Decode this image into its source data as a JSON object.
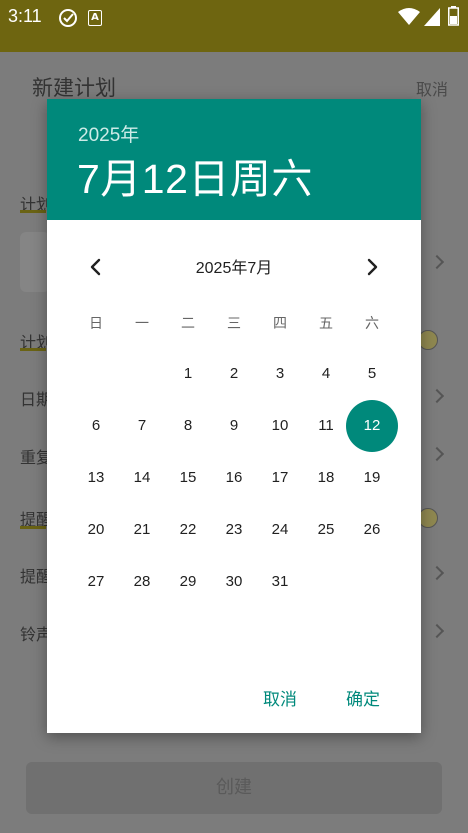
{
  "status_bar": {
    "time": "3:11",
    "icons": [
      "check-circle-icon",
      "a-badge-icon",
      "wifi-icon",
      "signal-icon",
      "battery-icon"
    ]
  },
  "background_page": {
    "title": "新建计划",
    "cancel_label": "取消",
    "row_labels": [
      "计划",
      "计划",
      "日期",
      "重复",
      "提醒",
      "提醒",
      "铃声"
    ],
    "create_label": "创建"
  },
  "dialog": {
    "header_year": "2025年",
    "header_date": "7月12日周六",
    "month_label": "2025年7月",
    "weekdays": [
      "日",
      "一",
      "二",
      "三",
      "四",
      "五",
      "六"
    ],
    "days": [
      "1",
      "2",
      "3",
      "4",
      "5",
      "6",
      "7",
      "8",
      "9",
      "10",
      "11",
      "12",
      "13",
      "14",
      "15",
      "16",
      "17",
      "18",
      "19",
      "20",
      "21",
      "22",
      "23",
      "24",
      "25",
      "26",
      "27",
      "28",
      "29",
      "30",
      "31"
    ],
    "selected_day": "12",
    "cancel_label": "取消",
    "ok_label": "确定",
    "colors": {
      "header_bg": "#00897b",
      "accent": "#00897b",
      "status_bar": "#6e6510"
    }
  }
}
